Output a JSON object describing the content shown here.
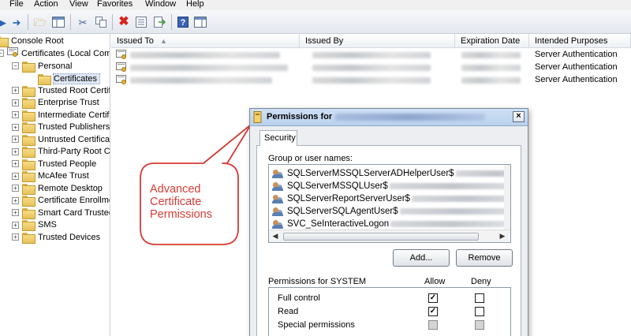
{
  "menu": [
    "File",
    "Action",
    "View",
    "Favorites",
    "Window",
    "Help"
  ],
  "toolbar": {
    "icons": [
      "back-arrow-icon",
      "forward-arrow-icon",
      "up-folder-icon",
      "show-hide-tree-icon",
      "cut-icon",
      "copy-icon",
      "delete-icon",
      "properties-icon",
      "export-list-icon",
      "help-icon",
      "show-hide-action-pane-icon"
    ]
  },
  "tree": {
    "root": "Console Root",
    "store": "Certificates (Local Com",
    "personal": "Personal",
    "certificates": "Certificates",
    "items": [
      "Trusted Root Certifi",
      "Enterprise Trust",
      "Intermediate Certifi",
      "Trusted Publishers",
      "Untrusted Certifica",
      "Third-Party Root C",
      "Trusted People",
      "McAfee Trust",
      "Remote Desktop",
      "Certificate Enrollme",
      "Smart Card Trusted",
      "SMS",
      "Trusted Devices"
    ]
  },
  "list": {
    "columns": [
      "Issued To",
      "Issued By",
      "Expiration Date",
      "Intended Purposes"
    ],
    "rows": [
      {
        "purpose": "Server Authentication"
      },
      {
        "purpose": "Server Authentication"
      },
      {
        "purpose": "Server Authentication"
      }
    ]
  },
  "dialog": {
    "title": "Permissions for",
    "tab": "Security",
    "group_label": "Group or user names:",
    "users": [
      "SQLServerMSSQLServerADHelperUser$",
      "SQLServerMSSQLUser$",
      "SQLServerReportServerUser$",
      "SQLServerSQLAgentUser$",
      "SVC_SeInteractiveLogon"
    ],
    "add_button": "Add...",
    "remove_button": "Remove",
    "perm_label": "Permissions for SYSTEM",
    "allow": "Allow",
    "deny": "Deny",
    "permissions": [
      {
        "name": "Full control",
        "allow": true,
        "deny": false,
        "disabled": false
      },
      {
        "name": "Read",
        "allow": true,
        "deny": false,
        "disabled": false
      },
      {
        "name": "Special permissions",
        "allow": false,
        "deny": false,
        "disabled": true
      }
    ],
    "close": "×"
  },
  "callout": {
    "lines": [
      "Advanced",
      "Certificate",
      "Permissions"
    ],
    "color": "#d53b35"
  }
}
